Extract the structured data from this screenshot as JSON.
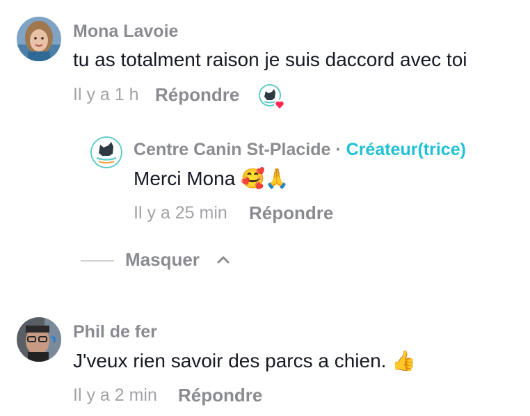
{
  "comments": [
    {
      "username": "Mona Lavoie",
      "text": "tu as totalment raison je suis daccord avec toi",
      "time": "Il y a 1 h",
      "reply_label": "Répondre",
      "replies": [
        {
          "username": "Centre Canin St-Placide",
          "separator": "·",
          "badge": "Créateur(trice)",
          "text": "Merci Mona",
          "emoji": "🥰🙏",
          "time": "Il y a 25 min",
          "reply_label": "Répondre"
        }
      ]
    },
    {
      "username": "Phil de fer",
      "text": "J'veux rien savoir des parcs a chien.",
      "emoji": "👍",
      "time": "Il y a 2 min",
      "reply_label": "Répondre"
    }
  ],
  "thread": {
    "hide_label": "Masquer"
  },
  "colors": {
    "username": "#8a8b91",
    "text": "#161823",
    "creator_badge": "#20c1d4",
    "liked_heart": "#fe2c55"
  },
  "icons": {
    "creator_liked": "dog-logo-with-heart-icon",
    "chevron": "chevron-up-icon"
  }
}
